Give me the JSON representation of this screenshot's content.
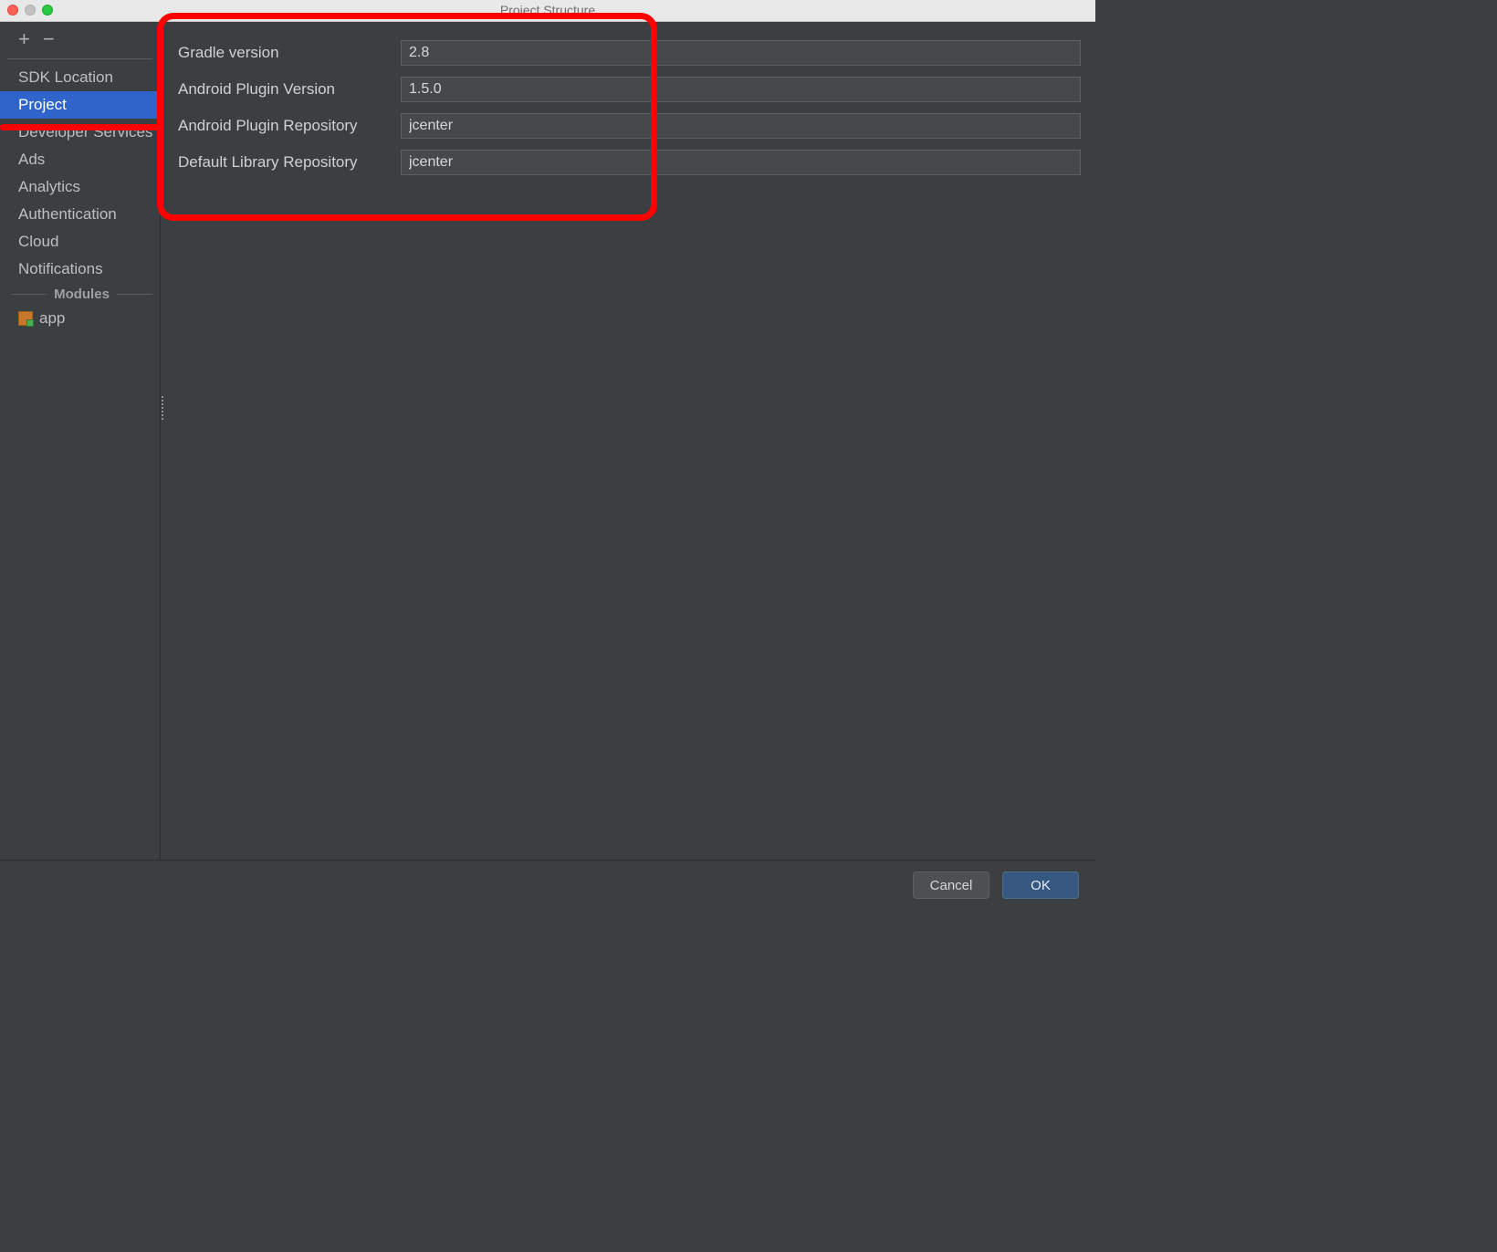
{
  "window": {
    "title": "Project Structure"
  },
  "sidebar": {
    "items": [
      {
        "label": "SDK Location"
      },
      {
        "label": "Project",
        "selected": true
      },
      {
        "label": "Developer Services"
      },
      {
        "label": "Ads"
      },
      {
        "label": "Analytics"
      },
      {
        "label": "Authentication"
      },
      {
        "label": "Cloud"
      },
      {
        "label": "Notifications"
      }
    ],
    "modules_header": "Modules",
    "modules": [
      {
        "label": "app"
      }
    ]
  },
  "fields": {
    "gradle_version": {
      "label": "Gradle version",
      "value": "2.8"
    },
    "plugin_version": {
      "label": "Android Plugin Version",
      "value": "1.5.0"
    },
    "plugin_repository": {
      "label": "Android Plugin Repository",
      "value": "jcenter"
    },
    "library_repository": {
      "label": "Default Library Repository",
      "value": "jcenter"
    }
  },
  "buttons": {
    "cancel": "Cancel",
    "ok": "OK"
  }
}
